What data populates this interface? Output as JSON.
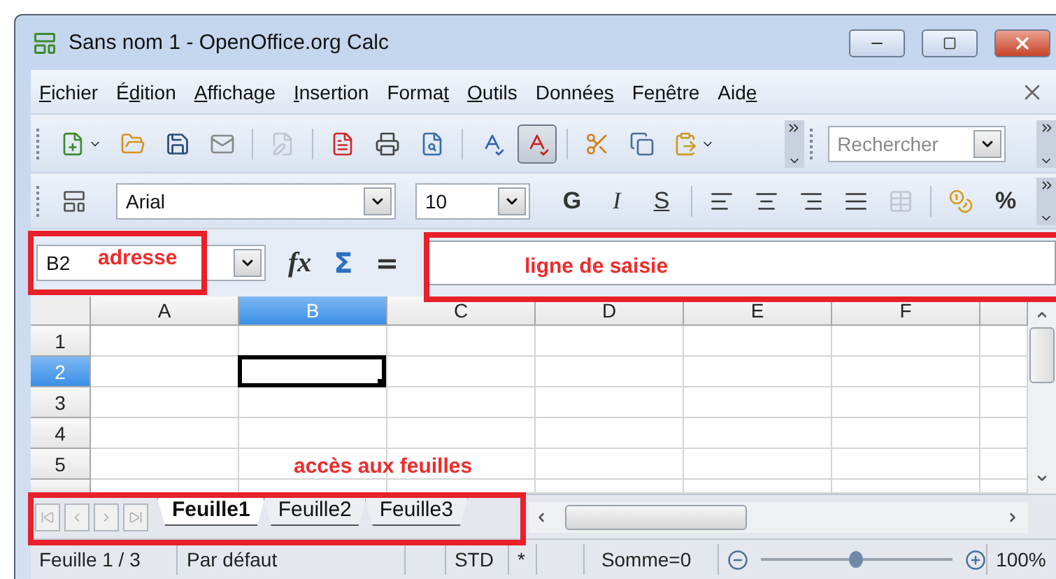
{
  "window": {
    "title": "Sans nom 1 - OpenOffice.org Calc"
  },
  "menu": [
    {
      "key": "F",
      "post": "ichier"
    },
    {
      "pre": "É",
      "key": "d",
      "post": "ition"
    },
    {
      "key": "A",
      "post": "ffichage"
    },
    {
      "key": "I",
      "post": "nsertion"
    },
    {
      "pre": "Forma",
      "key": "t"
    },
    {
      "key": "O",
      "post": "utils"
    },
    {
      "pre": "Donnée",
      "key": "s"
    },
    {
      "pre": "Fe",
      "key": "n",
      "post": "être"
    },
    {
      "pre": "Aid",
      "key": "e"
    }
  ],
  "standard_toolbar": {
    "edit_mode_button": {
      "disabled": true
    },
    "autospellcheck_button": {
      "selected": true
    },
    "search": {
      "placeholder": "Rechercher"
    }
  },
  "formatting_toolbar": {
    "font_name": "Arial",
    "font_size": "10",
    "style_buttons": [
      "G",
      "I",
      "S"
    ],
    "borders_button": {
      "disabled": true
    },
    "percent_button": "%"
  },
  "formula_bar": {
    "name_box": "B2",
    "function_wizard": "fx",
    "sum": "Σ",
    "equals": "="
  },
  "table": {
    "columns": [
      {
        "label": "A",
        "selected": false
      },
      {
        "label": "B",
        "selected": true
      },
      {
        "label": "C",
        "selected": false
      },
      {
        "label": "D",
        "selected": false
      },
      {
        "label": "E",
        "selected": false
      },
      {
        "label": "F",
        "selected": false
      }
    ],
    "rows": [
      {
        "label": "1",
        "selected": false
      },
      {
        "label": "2",
        "selected": true
      },
      {
        "label": "3",
        "selected": false
      },
      {
        "label": "4",
        "selected": false
      },
      {
        "label": "5",
        "selected": false
      }
    ]
  },
  "sheet_tabs": [
    {
      "label": "Feuille1",
      "selected": true
    },
    {
      "label": "Feuille2",
      "selected": false
    },
    {
      "label": "Feuille3",
      "selected": false
    }
  ],
  "status_bar": {
    "sheet": "Feuille 1 / 3",
    "page_style": "Par défaut",
    "mode": "STD",
    "modified": "*",
    "sum": "Somme=0",
    "zoom": {
      "level": 0.5
    },
    "zoom_reading": "100%"
  },
  "annotations": {
    "address": "adresse",
    "input_line": "ligne de saisie",
    "sheets": "accès aux feuilles"
  }
}
